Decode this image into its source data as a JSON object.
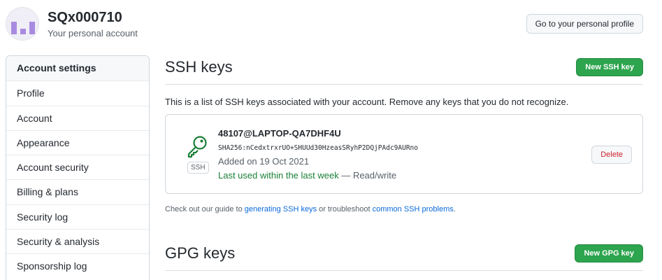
{
  "header": {
    "username": "SQx000710",
    "subtitle": "Your personal account",
    "profile_button": "Go to your personal profile"
  },
  "sidebar": {
    "items": [
      {
        "label": "Account settings"
      },
      {
        "label": "Profile"
      },
      {
        "label": "Account"
      },
      {
        "label": "Appearance"
      },
      {
        "label": "Account security"
      },
      {
        "label": "Billing & plans"
      },
      {
        "label": "Security log"
      },
      {
        "label": "Security & analysis"
      },
      {
        "label": "Sponsorship log"
      }
    ]
  },
  "ssh": {
    "title": "SSH keys",
    "new_button": "New SSH key",
    "description": "This is a list of SSH keys associated with your account. Remove any keys that you do not recognize.",
    "key": {
      "icon": "key-icon",
      "badge": "SSH",
      "name": "48107@LAPTOP-QA7DHF4U",
      "fingerprint": "SHA256:nCedxtrxrUO+SHUUd30HzeasSRyhP2DQjPAdc9AURno",
      "added": "Added on 19 Oct 2021",
      "last_used": "Last used within the last week",
      "access": " — Read/write",
      "delete_button": "Delete"
    },
    "guide": {
      "prefix": "Check out our guide to ",
      "link1": "generating SSH keys",
      "middle": " or troubleshoot ",
      "link2": "common SSH problems",
      "suffix": "."
    }
  },
  "gpg": {
    "title": "GPG keys",
    "new_button": "New GPG key"
  },
  "colors": {
    "accent_green": "#2da44e",
    "link_blue": "#0969da",
    "danger_red": "#cf222e"
  }
}
